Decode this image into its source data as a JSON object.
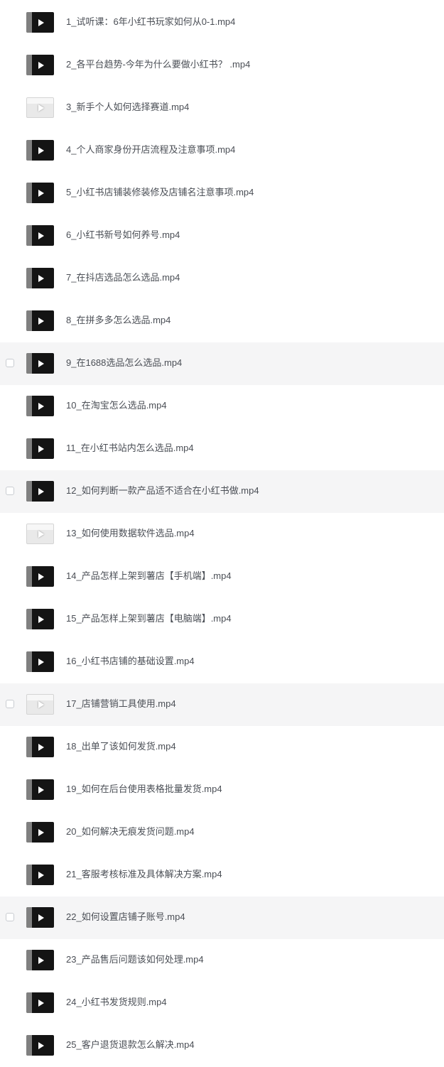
{
  "files": [
    {
      "name": "1_试听课：6年小红书玩家如何从0-1.mp4",
      "selected": false,
      "hovered": false,
      "thumb": "dark",
      "thumb_icon": "video-thumbnail-icon"
    },
    {
      "name": "2_各平台趋势-今年为什么要做小红书？ .mp4",
      "selected": false,
      "hovered": false,
      "thumb": "dark",
      "thumb_icon": "video-thumbnail-icon"
    },
    {
      "name": "3_新手个人如何选择赛道.mp4",
      "selected": false,
      "hovered": false,
      "thumb": "light",
      "thumb_icon": "video-thumbnail-icon"
    },
    {
      "name": "4_个人商家身份开店流程及注意事项.mp4",
      "selected": false,
      "hovered": false,
      "thumb": "dark",
      "thumb_icon": "video-thumbnail-icon"
    },
    {
      "name": "5_小红书店铺装修装修及店铺名注意事项.mp4",
      "selected": false,
      "hovered": false,
      "thumb": "dark",
      "thumb_icon": "video-thumbnail-icon"
    },
    {
      "name": "6_小红书新号如何养号.mp4",
      "selected": false,
      "hovered": false,
      "thumb": "dark",
      "thumb_icon": "video-thumbnail-icon"
    },
    {
      "name": "7_在抖店选品怎么选品.mp4",
      "selected": false,
      "hovered": false,
      "thumb": "dark",
      "thumb_icon": "video-thumbnail-icon"
    },
    {
      "name": "8_在拼多多怎么选品.mp4",
      "selected": false,
      "hovered": false,
      "thumb": "dark",
      "thumb_icon": "video-thumbnail-icon"
    },
    {
      "name": "9_在1688选品怎么选品.mp4",
      "selected": false,
      "hovered": true,
      "thumb": "dark",
      "thumb_icon": "video-thumbnail-icon"
    },
    {
      "name": "10_在淘宝怎么选品.mp4",
      "selected": false,
      "hovered": false,
      "thumb": "dark",
      "thumb_icon": "video-thumbnail-icon"
    },
    {
      "name": "11_在小红书站内怎么选品.mp4",
      "selected": false,
      "hovered": false,
      "thumb": "dark",
      "thumb_icon": "video-thumbnail-icon"
    },
    {
      "name": "12_如何判断一款产品适不适合在小红书做.mp4",
      "selected": false,
      "hovered": true,
      "thumb": "dark",
      "thumb_icon": "video-thumbnail-icon"
    },
    {
      "name": "13_如何使用数据软件选品.mp4",
      "selected": false,
      "hovered": false,
      "thumb": "light",
      "thumb_icon": "video-thumbnail-icon"
    },
    {
      "name": "14_产品怎样上架到薯店【手机端】.mp4",
      "selected": false,
      "hovered": false,
      "thumb": "dark",
      "thumb_icon": "video-thumbnail-icon"
    },
    {
      "name": "15_产品怎样上架到薯店【电脑端】.mp4",
      "selected": false,
      "hovered": false,
      "thumb": "dark",
      "thumb_icon": "video-thumbnail-icon"
    },
    {
      "name": "16_小红书店铺的基础设置.mp4",
      "selected": false,
      "hovered": false,
      "thumb": "dark",
      "thumb_icon": "video-thumbnail-icon"
    },
    {
      "name": "17_店铺营销工具使用.mp4",
      "selected": false,
      "hovered": true,
      "thumb": "light",
      "thumb_icon": "video-thumbnail-icon"
    },
    {
      "name": "18_出单了该如何发货.mp4",
      "selected": false,
      "hovered": false,
      "thumb": "dark",
      "thumb_icon": "video-thumbnail-icon"
    },
    {
      "name": "19_如何在后台使用表格批量发货.mp4",
      "selected": false,
      "hovered": false,
      "thumb": "dark",
      "thumb_icon": "video-thumbnail-icon"
    },
    {
      "name": "20_如何解决无痕发货问题.mp4",
      "selected": false,
      "hovered": false,
      "thumb": "dark",
      "thumb_icon": "video-thumbnail-icon"
    },
    {
      "name": "21_客服考核标准及具体解决方案.mp4",
      "selected": false,
      "hovered": false,
      "thumb": "dark",
      "thumb_icon": "video-thumbnail-icon"
    },
    {
      "name": "22_如何设置店铺子账号.mp4",
      "selected": false,
      "hovered": true,
      "thumb": "dark",
      "thumb_icon": "video-thumbnail-icon"
    },
    {
      "name": "23_产品售后问题该如何处理.mp4",
      "selected": false,
      "hovered": false,
      "thumb": "dark",
      "thumb_icon": "video-thumbnail-icon"
    },
    {
      "name": "24_小红书发货规则.mp4",
      "selected": false,
      "hovered": false,
      "thumb": "dark",
      "thumb_icon": "video-thumbnail-icon"
    },
    {
      "name": "25_客户退货退款怎么解决.mp4",
      "selected": false,
      "hovered": false,
      "thumb": "dark",
      "thumb_icon": "video-thumbnail-icon"
    }
  ],
  "colors": {
    "text": "#4b4f56",
    "hover_row": "#f5f5f6",
    "thumb_dark": "#141414",
    "thumb_light": "#e9e9e9",
    "checkbox_border": "#c9ccd1"
  }
}
